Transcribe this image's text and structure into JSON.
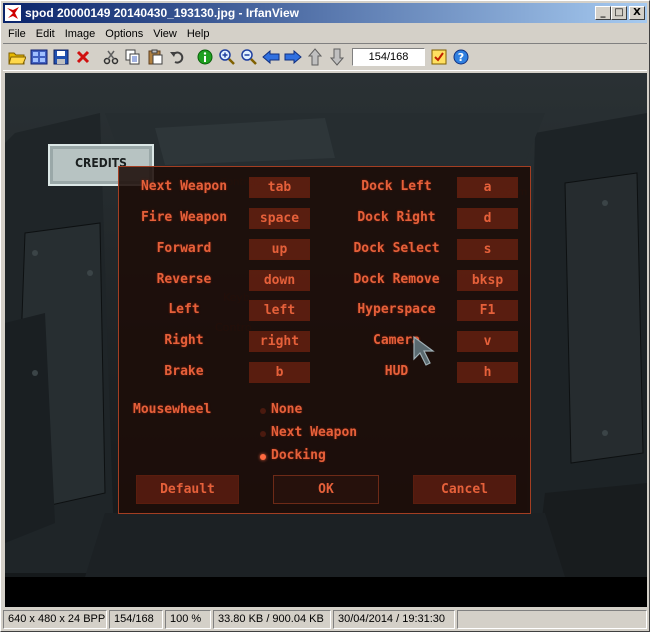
{
  "window": {
    "title": "spod 20000149 20140430_193130.jpg - IrfanView",
    "minimize_label": "_",
    "maximize_label": "□",
    "close_label": "X"
  },
  "menu": [
    "File",
    "Edit",
    "Image",
    "Options",
    "View",
    "Help"
  ],
  "toolbar": {
    "page_value": "154/168",
    "icons": [
      "open-icon",
      "thumbnails-icon",
      "save-icon",
      "delete-icon",
      "cut-icon",
      "copy-icon",
      "paste-icon",
      "undo-icon",
      "info-icon",
      "zoom-in-icon",
      "zoom-out-icon",
      "previous-icon",
      "next-icon",
      "upload-icon",
      "download-icon",
      "slideshow-icon",
      "help-icon"
    ]
  },
  "scene": {
    "credits_label": "CREDITS"
  },
  "dialog": {
    "left_bindings": [
      {
        "action": "Next Weapon",
        "key": "tab"
      },
      {
        "action": "Fire Weapon",
        "key": "space"
      },
      {
        "action": "Forward",
        "key": "up"
      },
      {
        "action": "Reverse",
        "key": "down"
      },
      {
        "action": "Left",
        "key": "left"
      },
      {
        "action": "Right",
        "key": "right"
      },
      {
        "action": "Brake",
        "key": "b"
      }
    ],
    "right_bindings": [
      {
        "action": "Dock Left",
        "key": "a"
      },
      {
        "action": "Dock Right",
        "key": "d"
      },
      {
        "action": "Dock Select",
        "key": "s"
      },
      {
        "action": "Dock Remove",
        "key": "bksp"
      },
      {
        "action": "Hyperspace",
        "key": "F1"
      },
      {
        "action": "Camera",
        "key": "v"
      },
      {
        "action": "HUD",
        "key": "h"
      }
    ],
    "mousewheel_label": "Mousewheel",
    "mousewheel_options": [
      "None",
      "Next Weapon",
      "Docking"
    ],
    "mousewheel_selected": "Docking",
    "buttons": {
      "default": "Default",
      "ok": "OK",
      "cancel": "Cancel"
    }
  },
  "status": {
    "dimensions": "640 x 480 x 24 BPP",
    "page": "154/168",
    "zoom": "100 %",
    "size": "33.80 KB / 900.04 KB",
    "datetime": "30/04/2014 / 19:31:30"
  },
  "colors": {
    "titlebar_start": "#0a246a",
    "dialog_text": "#e5603a",
    "dialog_border": "#a33e22"
  }
}
